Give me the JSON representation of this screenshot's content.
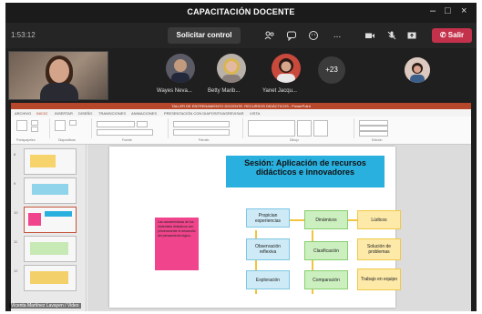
{
  "window": {
    "title": "CAPACITACIÓN DOCENTE",
    "minimize": "–",
    "maximize": "□",
    "close": "×"
  },
  "toolbar": {
    "time": "1:53:12",
    "control_label": "Solicitar control",
    "leave_label": "Salir",
    "more": "..."
  },
  "participants": {
    "tiles": [
      {
        "name": "Wayes Neva..."
      },
      {
        "name": "Betty Marib..."
      },
      {
        "name": "Yanet Jacqu..."
      }
    ],
    "more_count": "+23"
  },
  "powerpoint": {
    "title_bar": "TALLER DE ENTRENAMIENTO DOCENTE: RECURSOS DIDÁCTICOS - PowerPoint",
    "tabs": [
      "ARCHIVO",
      "INICIO",
      "INSERTAR",
      "DISEÑO",
      "TRANSICIONES",
      "ANIMACIONES",
      "PRESENTACIÓN CON DIAPOSITIVAS",
      "REVISAR",
      "VISTA"
    ],
    "ribbon_groups": [
      "Portapapeles",
      "Diapositivas",
      "Fuente",
      "Párrafo",
      "Dibujo",
      "Edición"
    ]
  },
  "slide": {
    "title": "Sesión: Aplicación de recursos didácticos e innovadores",
    "pink_text": "Las características de los materiales didácticos son primeramente el desarrollo del pensamiento lógico.",
    "boxes": {
      "propician": "Propician experiencias",
      "observacion": "Observación reflexiva",
      "exploracion": "Exploración",
      "dinamicos": "Dinámicos",
      "clasificacion": "Clasificación",
      "comparacion": "Comparación",
      "ludicos": "Lúdicos",
      "solucion": "Solución de problemas",
      "trabajo": "Trabajo en equipo"
    }
  },
  "caption": "Vicenta Martínez Lavayen / Video"
}
